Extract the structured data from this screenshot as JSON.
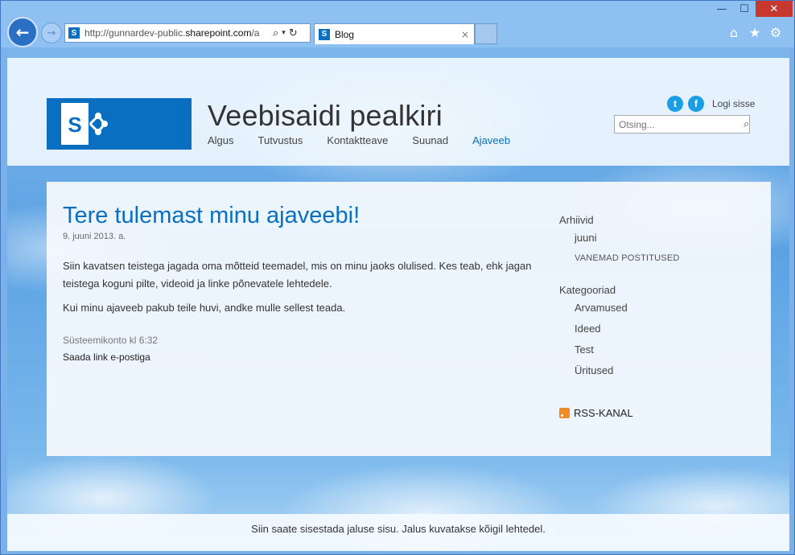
{
  "browser": {
    "window_controls": {
      "minimize": "—",
      "maximize": "☐",
      "close": "✕"
    },
    "address": {
      "prefix": "http://gunnardev-public.",
      "domain": "sharepoint.com",
      "suffix": "/a"
    },
    "tab": {
      "title": "Blog",
      "close": "×"
    },
    "icons": [
      "home-icon",
      "favorites-star-icon",
      "settings-gear-icon"
    ]
  },
  "site": {
    "title": "Veebisaidi pealkiri",
    "nav": [
      {
        "label": "Algus",
        "active": false
      },
      {
        "label": "Tutvustus",
        "active": false
      },
      {
        "label": "Kontaktteave",
        "active": false
      },
      {
        "label": "Suunad",
        "active": false
      },
      {
        "label": "Ajaveeb",
        "active": true
      }
    ],
    "signin": "Logi sisse",
    "search_placeholder": "Otsing..."
  },
  "post": {
    "title": "Tere tulemast minu ajaveebi!",
    "date": "9. juuni 2013. a.",
    "body": [
      "Siin kavatsen teistega jagada oma mõtteid teemadel, mis on minu jaoks olulised. Kes teab, ehk jagan teistega koguni pilte, videoid ja linke põnevatele lehtedele.",
      "Kui minu ajaveeb pakub teile huvi, andke mulle sellest teada."
    ],
    "meta": "Süsteemikonto kl 6:32",
    "email_link": "Saada link e-postiga"
  },
  "sidebar": {
    "archives_heading": "Arhiivid",
    "archives": [
      "juuni"
    ],
    "older_posts": "VANEMAD POSTITUSED",
    "categories_heading": "Kategooriad",
    "categories": [
      "Arvamused",
      "Ideed",
      "Test",
      "Üritused"
    ],
    "rss": "RSS-KANAL"
  },
  "footer": "Siin saate sisestada jaluse sisu. Jalus kuvatakse kõigil lehtedel.",
  "colors": {
    "accent": "#0a6fc1",
    "rss": "#f08a24",
    "twitter": "#1a9ee5"
  }
}
